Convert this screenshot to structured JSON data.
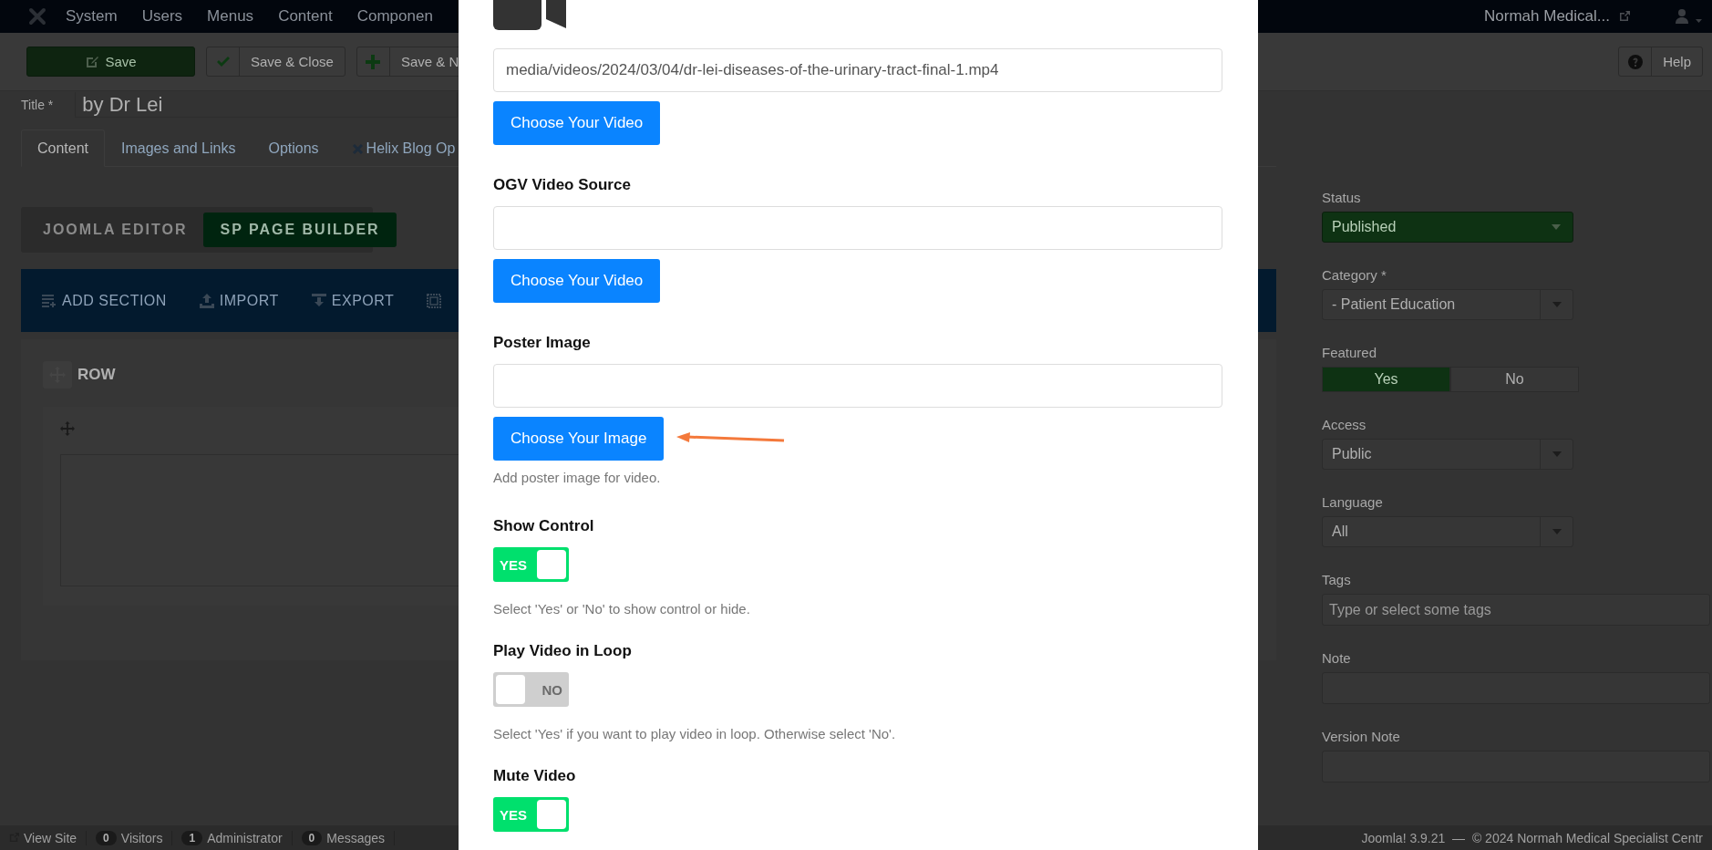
{
  "top_menu": {
    "items": [
      "System",
      "Users",
      "Menus",
      "Content",
      "Componen"
    ],
    "site_link": "Normah Medical..."
  },
  "toolbar": {
    "buttons": [
      {
        "label": "Save",
        "kind": "primary"
      },
      {
        "label": "Save & Close",
        "kind": "check"
      },
      {
        "label": "Save & N",
        "kind": "plus"
      }
    ],
    "help": "Help"
  },
  "title_field": {
    "label": "Title *",
    "value": "by Dr Lei"
  },
  "tabs": [
    {
      "label": "Content",
      "selected": true,
      "kind": "plain"
    },
    {
      "label": "Images and Links",
      "selected": false,
      "kind": "plain"
    },
    {
      "label": "Options",
      "selected": false,
      "kind": "plain"
    },
    {
      "label": "Helix Blog Op",
      "selected": false,
      "kind": "helix"
    }
  ],
  "editor_switch": [
    {
      "label": "JOOMLA EDITOR",
      "selected": false
    },
    {
      "label": "SP PAGE BUILDER",
      "selected": true
    }
  ],
  "builder_toolbar": [
    {
      "label": "ADD SECTION",
      "kind": "add"
    },
    {
      "label": "IMPORT",
      "kind": "import"
    },
    {
      "label": "EXPORT",
      "kind": "export"
    }
  ],
  "row": {
    "title": "ROW"
  },
  "sidebar": [
    {
      "kind": "status",
      "label": "Status",
      "value": "Published"
    },
    {
      "kind": "select",
      "label": "Category *",
      "value": "- Patient Education"
    },
    {
      "kind": "choice",
      "label": "Featured",
      "options": [
        {
          "label": "Yes",
          "selected": true
        },
        {
          "label": "No",
          "selected": false
        }
      ]
    },
    {
      "kind": "select",
      "label": "Access",
      "value": "Public"
    },
    {
      "kind": "select",
      "label": "Language",
      "value": "All"
    },
    {
      "kind": "text",
      "label": "Tags",
      "placeholder": "Type or select some tags"
    },
    {
      "kind": "text",
      "label": "Note"
    },
    {
      "kind": "text",
      "label": "Version Note"
    }
  ],
  "modal": {
    "fields": [
      {
        "kind": "media",
        "value": "media/videos/2024/03/04/dr-lei-diseases-of-the-urinary-tract-final-1.mp4",
        "button": "Choose Your Video"
      },
      {
        "kind": "media",
        "label": "OGV Video Source",
        "button": "Choose Your Video"
      },
      {
        "kind": "media",
        "label": "Poster Image",
        "button": "Choose Your Image",
        "help": "Add poster image for video.",
        "annotated": true
      },
      {
        "kind": "toggle",
        "label": "Show Control",
        "on": true,
        "state_label": "YES",
        "help": "Select 'Yes' or 'No' to show control or hide."
      },
      {
        "kind": "toggle",
        "label": "Play Video in Loop",
        "on": false,
        "state_label": "NO",
        "help": "Select 'Yes' if you want to play video in loop. Otherwise select 'No'."
      },
      {
        "kind": "toggle",
        "label": "Mute Video",
        "on": true,
        "state_label": "YES"
      }
    ]
  },
  "status_bar": {
    "items": [
      {
        "kind": "link",
        "label": "View Site"
      },
      {
        "kind": "count",
        "count": "0",
        "label": "Visitors"
      },
      {
        "kind": "count",
        "count": "1",
        "label": "Administrator"
      },
      {
        "kind": "count",
        "count": "0",
        "label": "Messages"
      }
    ],
    "copyright": "Joomla! 3.9.21  —  © 2024 Normah Medical Specialist Centr"
  }
}
